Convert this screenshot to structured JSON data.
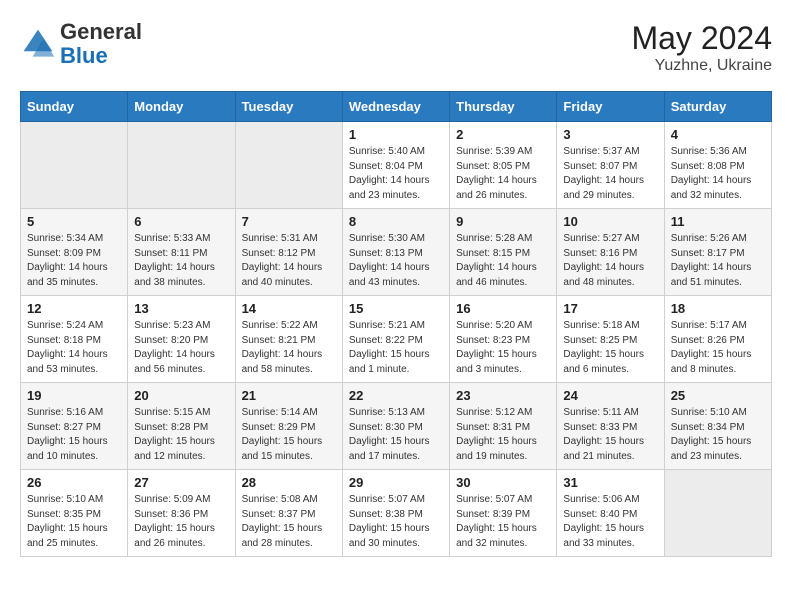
{
  "header": {
    "logo_general": "General",
    "logo_blue": "Blue",
    "month_year": "May 2024",
    "location": "Yuzhne, Ukraine"
  },
  "weekdays": [
    "Sunday",
    "Monday",
    "Tuesday",
    "Wednesday",
    "Thursday",
    "Friday",
    "Saturday"
  ],
  "weeks": [
    [
      {
        "day": "",
        "info": ""
      },
      {
        "day": "",
        "info": ""
      },
      {
        "day": "",
        "info": ""
      },
      {
        "day": "1",
        "info": "Sunrise: 5:40 AM\nSunset: 8:04 PM\nDaylight: 14 hours\nand 23 minutes."
      },
      {
        "day": "2",
        "info": "Sunrise: 5:39 AM\nSunset: 8:05 PM\nDaylight: 14 hours\nand 26 minutes."
      },
      {
        "day": "3",
        "info": "Sunrise: 5:37 AM\nSunset: 8:07 PM\nDaylight: 14 hours\nand 29 minutes."
      },
      {
        "day": "4",
        "info": "Sunrise: 5:36 AM\nSunset: 8:08 PM\nDaylight: 14 hours\nand 32 minutes."
      }
    ],
    [
      {
        "day": "5",
        "info": "Sunrise: 5:34 AM\nSunset: 8:09 PM\nDaylight: 14 hours\nand 35 minutes."
      },
      {
        "day": "6",
        "info": "Sunrise: 5:33 AM\nSunset: 8:11 PM\nDaylight: 14 hours\nand 38 minutes."
      },
      {
        "day": "7",
        "info": "Sunrise: 5:31 AM\nSunset: 8:12 PM\nDaylight: 14 hours\nand 40 minutes."
      },
      {
        "day": "8",
        "info": "Sunrise: 5:30 AM\nSunset: 8:13 PM\nDaylight: 14 hours\nand 43 minutes."
      },
      {
        "day": "9",
        "info": "Sunrise: 5:28 AM\nSunset: 8:15 PM\nDaylight: 14 hours\nand 46 minutes."
      },
      {
        "day": "10",
        "info": "Sunrise: 5:27 AM\nSunset: 8:16 PM\nDaylight: 14 hours\nand 48 minutes."
      },
      {
        "day": "11",
        "info": "Sunrise: 5:26 AM\nSunset: 8:17 PM\nDaylight: 14 hours\nand 51 minutes."
      }
    ],
    [
      {
        "day": "12",
        "info": "Sunrise: 5:24 AM\nSunset: 8:18 PM\nDaylight: 14 hours\nand 53 minutes."
      },
      {
        "day": "13",
        "info": "Sunrise: 5:23 AM\nSunset: 8:20 PM\nDaylight: 14 hours\nand 56 minutes."
      },
      {
        "day": "14",
        "info": "Sunrise: 5:22 AM\nSunset: 8:21 PM\nDaylight: 14 hours\nand 58 minutes."
      },
      {
        "day": "15",
        "info": "Sunrise: 5:21 AM\nSunset: 8:22 PM\nDaylight: 15 hours\nand 1 minute."
      },
      {
        "day": "16",
        "info": "Sunrise: 5:20 AM\nSunset: 8:23 PM\nDaylight: 15 hours\nand 3 minutes."
      },
      {
        "day": "17",
        "info": "Sunrise: 5:18 AM\nSunset: 8:25 PM\nDaylight: 15 hours\nand 6 minutes."
      },
      {
        "day": "18",
        "info": "Sunrise: 5:17 AM\nSunset: 8:26 PM\nDaylight: 15 hours\nand 8 minutes."
      }
    ],
    [
      {
        "day": "19",
        "info": "Sunrise: 5:16 AM\nSunset: 8:27 PM\nDaylight: 15 hours\nand 10 minutes."
      },
      {
        "day": "20",
        "info": "Sunrise: 5:15 AM\nSunset: 8:28 PM\nDaylight: 15 hours\nand 12 minutes."
      },
      {
        "day": "21",
        "info": "Sunrise: 5:14 AM\nSunset: 8:29 PM\nDaylight: 15 hours\nand 15 minutes."
      },
      {
        "day": "22",
        "info": "Sunrise: 5:13 AM\nSunset: 8:30 PM\nDaylight: 15 hours\nand 17 minutes."
      },
      {
        "day": "23",
        "info": "Sunrise: 5:12 AM\nSunset: 8:31 PM\nDaylight: 15 hours\nand 19 minutes."
      },
      {
        "day": "24",
        "info": "Sunrise: 5:11 AM\nSunset: 8:33 PM\nDaylight: 15 hours\nand 21 minutes."
      },
      {
        "day": "25",
        "info": "Sunrise: 5:10 AM\nSunset: 8:34 PM\nDaylight: 15 hours\nand 23 minutes."
      }
    ],
    [
      {
        "day": "26",
        "info": "Sunrise: 5:10 AM\nSunset: 8:35 PM\nDaylight: 15 hours\nand 25 minutes."
      },
      {
        "day": "27",
        "info": "Sunrise: 5:09 AM\nSunset: 8:36 PM\nDaylight: 15 hours\nand 26 minutes."
      },
      {
        "day": "28",
        "info": "Sunrise: 5:08 AM\nSunset: 8:37 PM\nDaylight: 15 hours\nand 28 minutes."
      },
      {
        "day": "29",
        "info": "Sunrise: 5:07 AM\nSunset: 8:38 PM\nDaylight: 15 hours\nand 30 minutes."
      },
      {
        "day": "30",
        "info": "Sunrise: 5:07 AM\nSunset: 8:39 PM\nDaylight: 15 hours\nand 32 minutes."
      },
      {
        "day": "31",
        "info": "Sunrise: 5:06 AM\nSunset: 8:40 PM\nDaylight: 15 hours\nand 33 minutes."
      },
      {
        "day": "",
        "info": ""
      }
    ]
  ]
}
